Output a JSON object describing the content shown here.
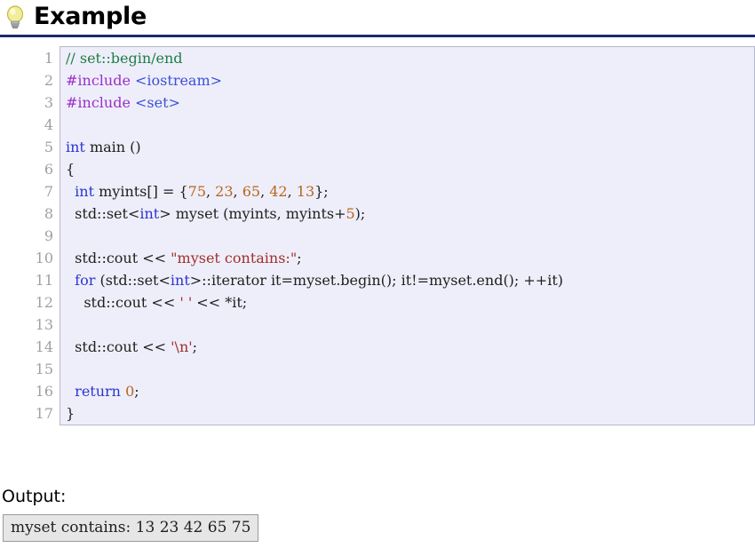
{
  "header": {
    "icon": "lightbulb-icon",
    "title": "Example",
    "rule_color": "#1c2a6e"
  },
  "code_block": {
    "language": "cpp",
    "background": "#eeeefa",
    "border_color": "#b8b8cc",
    "gutter_color": "#a0a0a0",
    "line_count": 17,
    "lines": [
      {
        "n": "1",
        "tokens": [
          {
            "t": "// set::begin/end",
            "c": "com"
          }
        ]
      },
      {
        "n": "2",
        "tokens": [
          {
            "t": "#include ",
            "c": "pre"
          },
          {
            "t": "<iostream>",
            "c": "hdr"
          }
        ]
      },
      {
        "n": "3",
        "tokens": [
          {
            "t": "#include ",
            "c": "pre"
          },
          {
            "t": "<set>",
            "c": "hdr"
          }
        ]
      },
      {
        "n": "4",
        "tokens": [
          {
            "t": "",
            "c": "id"
          }
        ]
      },
      {
        "n": "5",
        "tokens": [
          {
            "t": "int",
            "c": "kw"
          },
          {
            "t": " main ()",
            "c": "id"
          }
        ]
      },
      {
        "n": "6",
        "tokens": [
          {
            "t": "{",
            "c": "pun"
          }
        ]
      },
      {
        "n": "7",
        "tokens": [
          {
            "t": "  ",
            "c": "id"
          },
          {
            "t": "int",
            "c": "kw"
          },
          {
            "t": " myints[] = {",
            "c": "id"
          },
          {
            "t": "75",
            "c": "num"
          },
          {
            "t": ", ",
            "c": "id"
          },
          {
            "t": "23",
            "c": "num"
          },
          {
            "t": ", ",
            "c": "id"
          },
          {
            "t": "65",
            "c": "num"
          },
          {
            "t": ", ",
            "c": "id"
          },
          {
            "t": "42",
            "c": "num"
          },
          {
            "t": ", ",
            "c": "id"
          },
          {
            "t": "13",
            "c": "num"
          },
          {
            "t": "};",
            "c": "id"
          }
        ]
      },
      {
        "n": "8",
        "tokens": [
          {
            "t": "  std::set<",
            "c": "id"
          },
          {
            "t": "int",
            "c": "kw"
          },
          {
            "t": "> myset (myints, myints+",
            "c": "id"
          },
          {
            "t": "5",
            "c": "num"
          },
          {
            "t": ");",
            "c": "id"
          }
        ]
      },
      {
        "n": "9",
        "tokens": [
          {
            "t": "",
            "c": "id"
          }
        ]
      },
      {
        "n": "10",
        "tokens": [
          {
            "t": "  std::cout << ",
            "c": "id"
          },
          {
            "t": "\"myset contains:\"",
            "c": "str"
          },
          {
            "t": ";",
            "c": "id"
          }
        ]
      },
      {
        "n": "11",
        "tokens": [
          {
            "t": "  ",
            "c": "id"
          },
          {
            "t": "for",
            "c": "kw"
          },
          {
            "t": " (std::set<",
            "c": "id"
          },
          {
            "t": "int",
            "c": "kw"
          },
          {
            "t": ">::iterator it=myset.begin(); it!=myset.end(); ++it)",
            "c": "id"
          }
        ]
      },
      {
        "n": "12",
        "tokens": [
          {
            "t": "    std::cout << ",
            "c": "id"
          },
          {
            "t": "' '",
            "c": "str"
          },
          {
            "t": " << *it;",
            "c": "id"
          }
        ]
      },
      {
        "n": "13",
        "tokens": [
          {
            "t": "",
            "c": "id"
          }
        ]
      },
      {
        "n": "14",
        "tokens": [
          {
            "t": "  std::cout << ",
            "c": "id"
          },
          {
            "t": "'\\n'",
            "c": "str"
          },
          {
            "t": ";",
            "c": "id"
          }
        ]
      },
      {
        "n": "15",
        "tokens": [
          {
            "t": "",
            "c": "id"
          }
        ]
      },
      {
        "n": "16",
        "tokens": [
          {
            "t": "  ",
            "c": "id"
          },
          {
            "t": "return",
            "c": "kw"
          },
          {
            "t": " ",
            "c": "id"
          },
          {
            "t": "0",
            "c": "num"
          },
          {
            "t": ";",
            "c": "id"
          }
        ]
      },
      {
        "n": "17",
        "tokens": [
          {
            "t": "}",
            "c": "pun"
          }
        ]
      }
    ]
  },
  "output": {
    "label": "Output:",
    "text": "myset contains: 13 23 42 65 75",
    "background": "#e6e6e6",
    "border_color": "#9a9a9a"
  }
}
